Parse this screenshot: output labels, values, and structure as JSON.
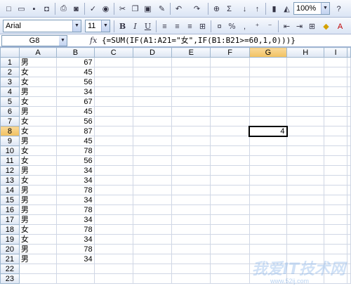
{
  "toolbar1": {
    "zoom": "100%"
  },
  "toolbar2": {
    "font_name": "Arial",
    "font_size": "11",
    "bold": "B",
    "italic": "I",
    "underline": "U",
    "percent": "%"
  },
  "formula_bar": {
    "name_box": "G8",
    "fx": "fx",
    "formula": "{=SUM(IF(A1:A21=\"女\",IF(B1:B21>=60,1,0)))}"
  },
  "columns": [
    "A",
    "B",
    "C",
    "D",
    "E",
    "F",
    "G",
    "H",
    "I"
  ],
  "active_cell": "G8",
  "rows": [
    {
      "num": "1",
      "a": "男",
      "b": "67"
    },
    {
      "num": "2",
      "a": "女",
      "b": "45"
    },
    {
      "num": "3",
      "a": "女",
      "b": "56"
    },
    {
      "num": "4",
      "a": "男",
      "b": "34"
    },
    {
      "num": "5",
      "a": "女",
      "b": "67"
    },
    {
      "num": "6",
      "a": "男",
      "b": "45"
    },
    {
      "num": "7",
      "a": "女",
      "b": "56"
    },
    {
      "num": "8",
      "a": "女",
      "b": "87",
      "g": "4"
    },
    {
      "num": "9",
      "a": "男",
      "b": "45"
    },
    {
      "num": "10",
      "a": "女",
      "b": "78"
    },
    {
      "num": "11",
      "a": "女",
      "b": "56"
    },
    {
      "num": "12",
      "a": "男",
      "b": "34"
    },
    {
      "num": "13",
      "a": "女",
      "b": "34"
    },
    {
      "num": "14",
      "a": "男",
      "b": "78"
    },
    {
      "num": "15",
      "a": "男",
      "b": "34"
    },
    {
      "num": "16",
      "a": "男",
      "b": "78"
    },
    {
      "num": "17",
      "a": "男",
      "b": "34"
    },
    {
      "num": "18",
      "a": "女",
      "b": "78"
    },
    {
      "num": "19",
      "a": "女",
      "b": "34"
    },
    {
      "num": "20",
      "a": "男",
      "b": "78"
    },
    {
      "num": "21",
      "a": "男",
      "b": "34"
    },
    {
      "num": "22",
      "a": "",
      "b": ""
    },
    {
      "num": "23",
      "a": "",
      "b": ""
    }
  ],
  "watermark": {
    "text": "我爱IT技术网",
    "url": "www.52ij.com"
  },
  "colors": {
    "selected_header": "#f1c15f",
    "grid_line": "#d0d7e5",
    "header_bg": "#dee6f3"
  }
}
